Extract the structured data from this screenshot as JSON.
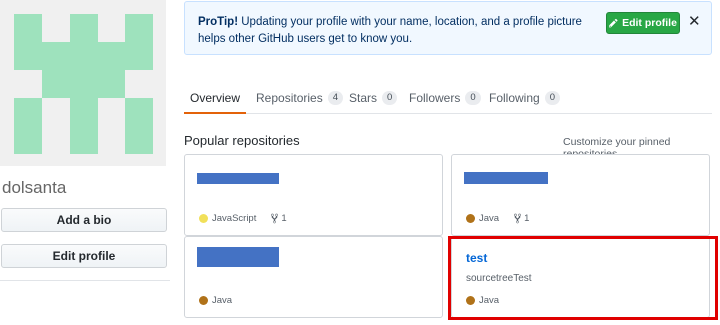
{
  "profile": {
    "username": "dolsanta",
    "add_bio_label": "Add a bio",
    "edit_profile_label": "Edit profile",
    "avatar_color": "#9ee2bd"
  },
  "protip": {
    "lead": "ProTip!",
    "text": " Updating your profile with your name, location, and a profile picture helps other GitHub users get to know you.",
    "button_label": "Edit profile",
    "close_glyph": "✕"
  },
  "tabs": [
    {
      "label": "Overview",
      "count": null,
      "active": true
    },
    {
      "label": "Repositories",
      "count": "4"
    },
    {
      "label": "Stars",
      "count": "0"
    },
    {
      "label": "Followers",
      "count": "0"
    },
    {
      "label": "Following",
      "count": "0"
    }
  ],
  "popular": {
    "title": "Popular repositories",
    "customize_label": "Customize your pinned repositories"
  },
  "repos": [
    {
      "name": "",
      "description": "",
      "language": "JavaScript",
      "language_color": "#f1e05a",
      "forks": "1"
    },
    {
      "name": "",
      "description": "",
      "language": "Java",
      "language_color": "#b07219",
      "forks": "1"
    },
    {
      "name": "",
      "description": "",
      "language": "Java",
      "language_color": "#b07219",
      "forks": ""
    },
    {
      "name": "test",
      "description": "sourcetreeTest",
      "language": "Java",
      "language_color": "#b07219",
      "forks": ""
    }
  ],
  "colors": {
    "accent_tab": "#e36209",
    "link": "#0366d6",
    "redaction": "#4472c4",
    "highlight_box": "#e00000",
    "primary_button": "#28a745"
  },
  "icons": {
    "protip_button": "pencil-icon",
    "fork": "repo-forked-icon",
    "close": "x-icon"
  }
}
